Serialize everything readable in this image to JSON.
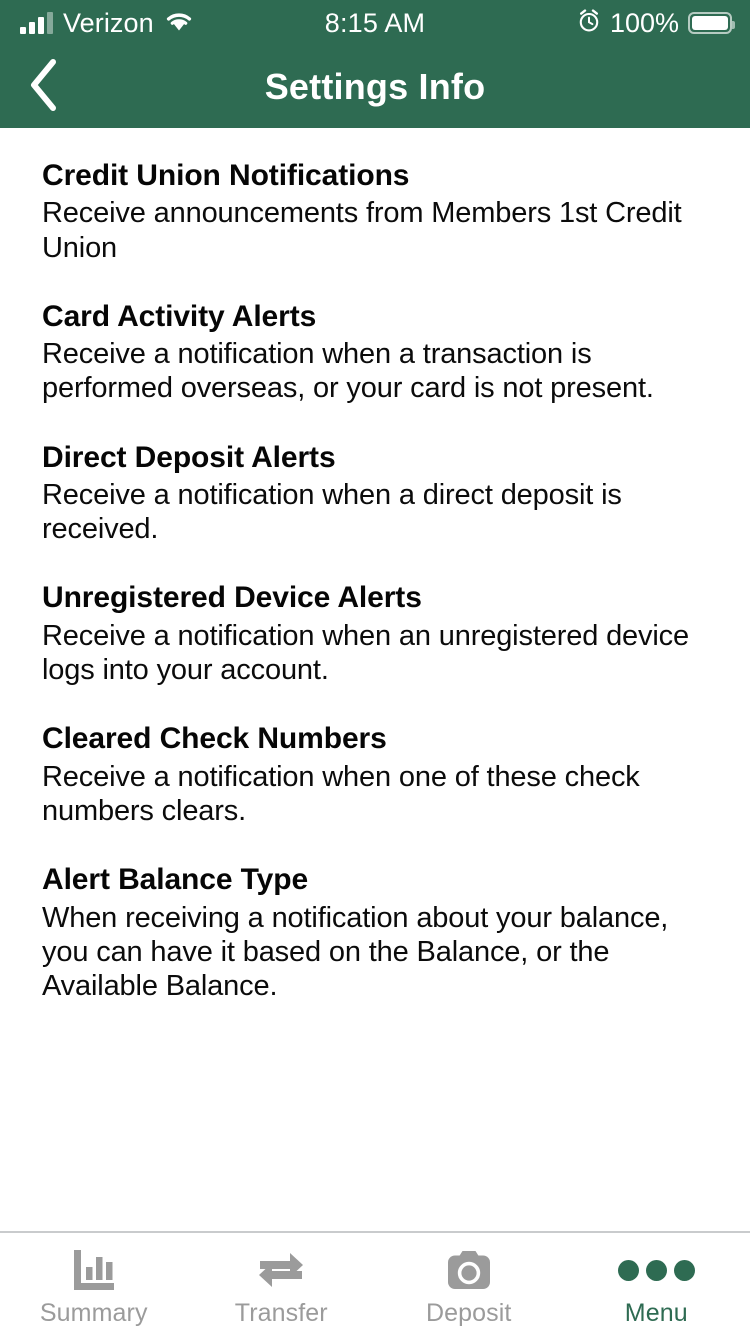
{
  "status_bar": {
    "carrier": "Verizon",
    "time": "8:15 AM",
    "battery_percent": "100%",
    "signal_icon": "signal-bars-icon",
    "wifi_icon": "wifi-icon",
    "alarm_icon": "alarm-clock-icon",
    "battery_icon": "battery-full-icon"
  },
  "nav": {
    "title": "Settings Info",
    "back_icon": "chevron-left-icon"
  },
  "colors": {
    "brand_green": "#2E6B52",
    "header_text": "#ffffff",
    "body_text": "#060606",
    "tab_inactive": "#9b9b9b",
    "tab_active": "#2E6B52",
    "divider": "#c9cbcd"
  },
  "sections": [
    {
      "title": "Credit Union Notifications",
      "description": "Receive announcements from Members 1st Credit Union"
    },
    {
      "title": "Card Activity Alerts",
      "description": "Receive a notification when a transaction is performed overseas, or your card is not present."
    },
    {
      "title": "Direct Deposit Alerts",
      "description": "Receive a notification when a direct deposit is received."
    },
    {
      "title": "Unregistered Device Alerts",
      "description": "Receive a notification when an unregistered device logs into your account."
    },
    {
      "title": "Cleared Check Numbers",
      "description": "Receive a notification when one of these check numbers clears."
    },
    {
      "title": "Alert Balance Type",
      "description": "When receiving a notification about your balance, you can have it based on the Balance, or the Available Balance."
    }
  ],
  "tab_bar": {
    "tabs": [
      {
        "label": "Summary",
        "icon": "bar-chart-icon",
        "active": false
      },
      {
        "label": "Transfer",
        "icon": "transfer-arrows-icon",
        "active": false
      },
      {
        "label": "Deposit",
        "icon": "camera-icon",
        "active": false
      },
      {
        "label": "Menu",
        "icon": "three-dots-icon",
        "active": true
      }
    ]
  }
}
